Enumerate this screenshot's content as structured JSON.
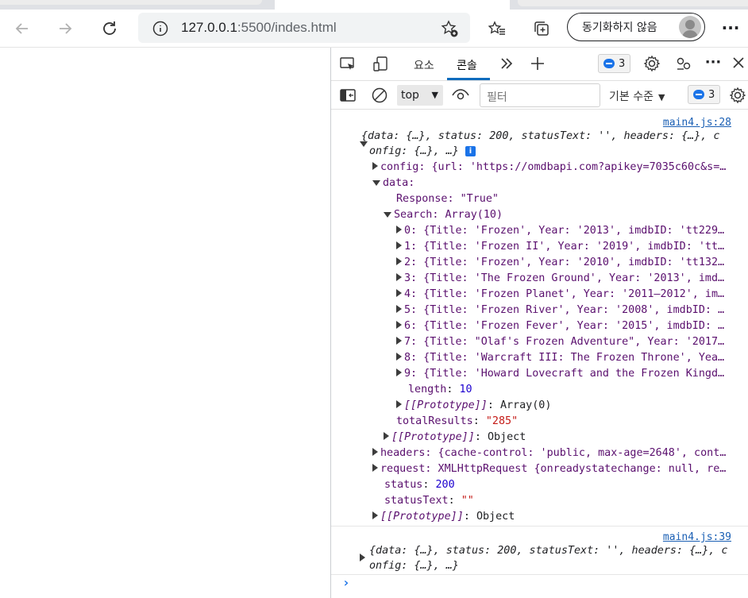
{
  "browser": {
    "url_host": "127.0.0.1",
    "url_path": ":5500/indes.html",
    "sync_label": "동기화하지 않음"
  },
  "devtools": {
    "tabs": {
      "elements": "요소",
      "console": "콘솔"
    },
    "badge_count": "3",
    "context": "top",
    "filter_placeholder": "필터",
    "level": "기본 수준",
    "sub_badge_count": "3"
  },
  "console": {
    "entries": [
      {
        "source": "main4.js:28",
        "summary_1": "{data: {…}, status: 200, statusText: '', headers: {…}, c",
        "summary_2": "onfig: {…}, …}",
        "lines": {
          "config": "config: {url: 'https://omdbapi.com?apikey=7035c60c&s=…",
          "data": "data:",
          "response": "Response: \"True\"",
          "search": "Search: Array(10)",
          "items": [
            "0: {Title: 'Frozen', Year: '2013', imdbID: 'tt229…",
            "1: {Title: 'Frozen II', Year: '2019', imdbID: 'tt…",
            "2: {Title: 'Frozen', Year: '2010', imdbID: 'tt132…",
            "3: {Title: 'The Frozen Ground', Year: '2013', imd…",
            "4: {Title: 'Frozen Planet', Year: '2011–2012', im…",
            "5: {Title: 'Frozen River', Year: '2008', imdbID: …",
            "6: {Title: 'Frozen Fever', Year: '2015', imdbID: …",
            "7: {Title: \"Olaf's Frozen Adventure\", Year: '2017…",
            "8: {Title: 'Warcraft III: The Frozen Throne', Yea…",
            "9: {Title: 'Howard Lovecraft and the Frozen Kingd…"
          ],
          "length_key": "length",
          "length_val": "10",
          "proto_array_key": "[[Prototype]]",
          "proto_array_val": "Array(0)",
          "total_key": "totalResults",
          "total_val": "\"285\"",
          "proto_obj_key": "[[Prototype]]",
          "proto_obj_val": "Object",
          "headers": "headers: {cache-control: 'public, max-age=2648', cont…",
          "request": "request: XMLHttpRequest {onreadystatechange: null, re…",
          "status_key": "status",
          "status_val": "200",
          "statustext_key": "statusText",
          "statustext_val": "\"\"",
          "proto_root_key": "[[Prototype]]",
          "proto_root_val": "Object"
        }
      },
      {
        "source": "main4.js:39",
        "summary_1": "{data: {…}, status: 200, statusText: '', headers: {…}, c",
        "summary_2": "onfig: {…}, …}"
      }
    ],
    "prompt": "›"
  }
}
